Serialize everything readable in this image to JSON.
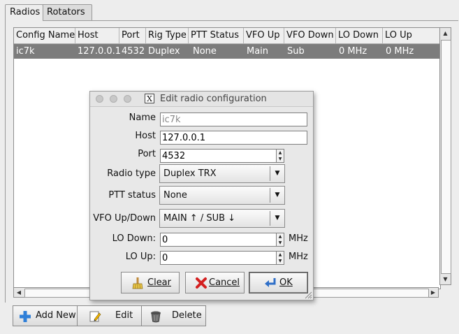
{
  "tabs": [
    {
      "label": "Radios",
      "active": true
    },
    {
      "label": "Rotators",
      "active": false
    }
  ],
  "table": {
    "columns": [
      "Config Name",
      "Host",
      "Port",
      "Rig Type",
      "PTT Status",
      "VFO Up",
      "VFO Down",
      "LO Down",
      "LO Up"
    ],
    "rows": [
      [
        "ic7k",
        "127.0.0.1",
        "4532",
        "Duplex",
        "None",
        "Main",
        "Sub",
        "0 MHz",
        "0 MHz"
      ]
    ]
  },
  "buttons": {
    "add_new": "Add New",
    "edit": "Edit",
    "delete": "Delete"
  },
  "dialog": {
    "title": "Edit radio configuration",
    "name_label": "Name",
    "name_value": "ic7k",
    "host_label": "Host",
    "host_value": "127.0.0.1",
    "port_label": "Port",
    "port_value": "4532",
    "radio_type_label": "Radio type",
    "radio_type_value": "Duplex TRX",
    "ptt_label": "PTT status",
    "ptt_value": "None",
    "vfo_label": "VFO Up/Down",
    "vfo_value": "MAIN ↑ / SUB ↓",
    "lo_down_label": "LO Down:",
    "lo_down_value": "0",
    "lo_up_label": "LO Up:",
    "lo_up_value": "0",
    "unit": "MHz",
    "clear_label": "Clear",
    "cancel_label": "Cancel",
    "ok_label": "OK"
  },
  "colors": {
    "selected_row": "#7c7c7c",
    "window_bg": "#ededed"
  }
}
